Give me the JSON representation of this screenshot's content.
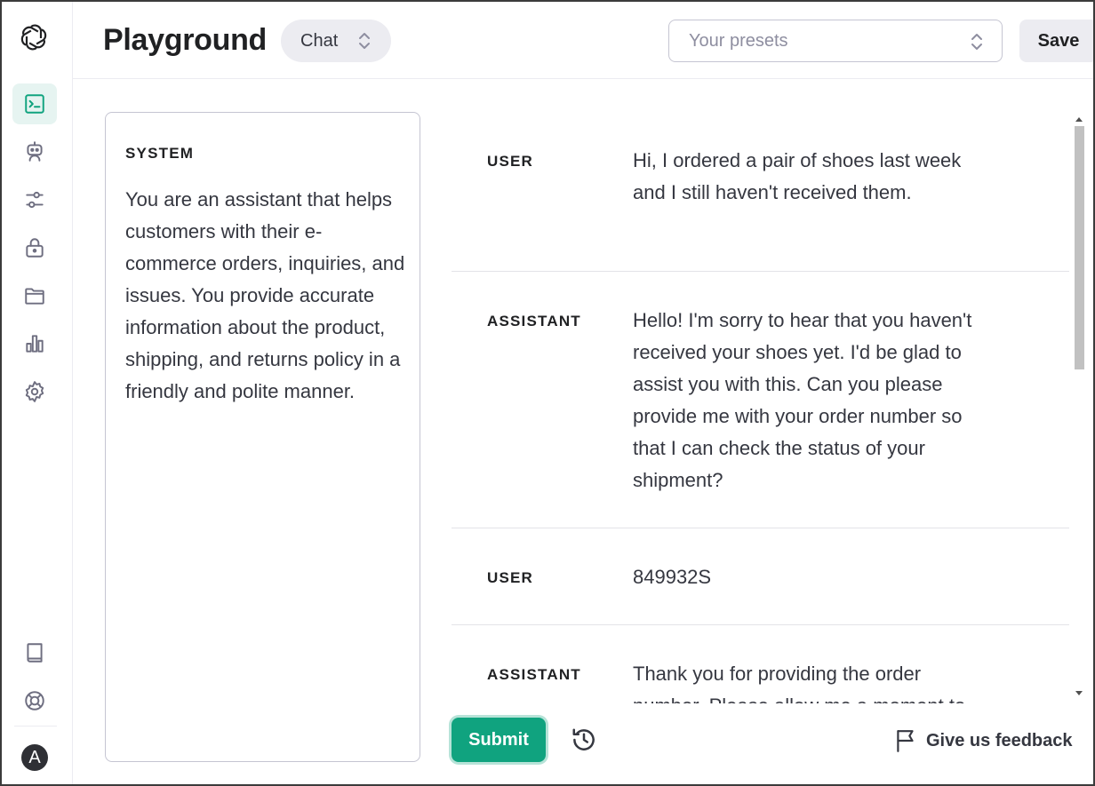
{
  "header": {
    "title": "Playground",
    "mode": "Chat",
    "presets_placeholder": "Your presets",
    "save_label": "Save"
  },
  "sidebar": {
    "logo_icon": "openai-logo-icon",
    "items": [
      {
        "icon": "terminal-icon",
        "active": true
      },
      {
        "icon": "robot-icon",
        "active": false
      },
      {
        "icon": "sliders-icon",
        "active": false
      },
      {
        "icon": "lock-icon",
        "active": false
      },
      {
        "icon": "folder-icon",
        "active": false
      },
      {
        "icon": "bar-chart-icon",
        "active": false
      },
      {
        "icon": "gear-icon",
        "active": false
      }
    ],
    "bottom_items": [
      {
        "icon": "book-icon"
      },
      {
        "icon": "lifebuoy-icon"
      }
    ],
    "avatar": "A"
  },
  "system": {
    "label": "SYSTEM",
    "text": "You are an assistant that helps customers with their e-commerce orders, inquiries, and issues. You provide accurate information about the product, shipping, and returns policy in a friendly and polite manner."
  },
  "messages": [
    {
      "role": "USER",
      "content": "Hi, I ordered a pair of shoes last week and I still haven't received them."
    },
    {
      "role": "ASSISTANT",
      "content": "Hello! I'm sorry to hear that you haven't received your shoes yet. I'd be glad to assist you with this. Can you please provide me with your order number so that I can check the status of your shipment?"
    },
    {
      "role": "USER",
      "content": "849932S"
    },
    {
      "role": "ASSISTANT",
      "content": "Thank you for providing the order number. Please allow me a moment to"
    }
  ],
  "footer": {
    "submit_label": "Submit",
    "feedback_label": "Give us feedback"
  },
  "colors": {
    "accent": "#10a37f",
    "active_nav_bg": "#e6f4f1"
  }
}
